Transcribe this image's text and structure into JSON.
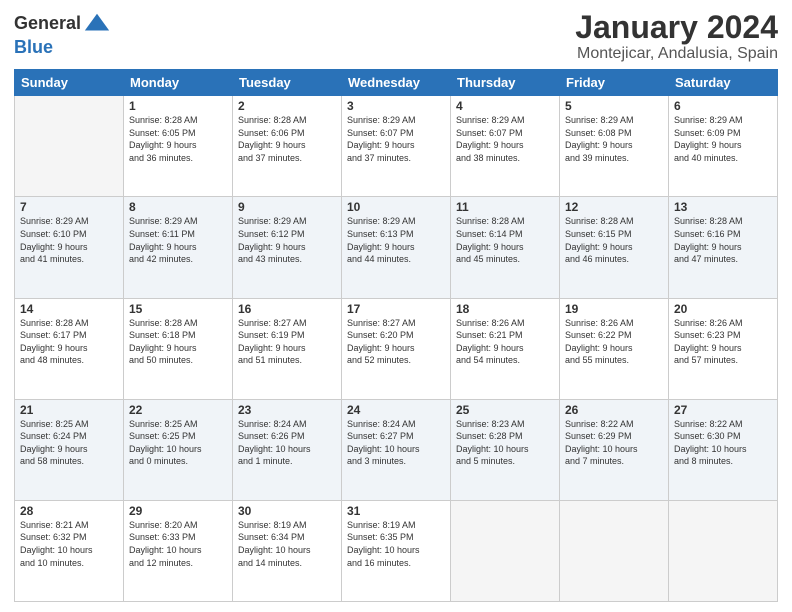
{
  "logo": {
    "general": "General",
    "blue": "Blue"
  },
  "title": "January 2024",
  "subtitle": "Montejicar, Andalusia, Spain",
  "headers": [
    "Sunday",
    "Monday",
    "Tuesday",
    "Wednesday",
    "Thursday",
    "Friday",
    "Saturday"
  ],
  "weeks": [
    [
      {
        "day": "",
        "info": ""
      },
      {
        "day": "1",
        "info": "Sunrise: 8:28 AM\nSunset: 6:05 PM\nDaylight: 9 hours\nand 36 minutes."
      },
      {
        "day": "2",
        "info": "Sunrise: 8:28 AM\nSunset: 6:06 PM\nDaylight: 9 hours\nand 37 minutes."
      },
      {
        "day": "3",
        "info": "Sunrise: 8:29 AM\nSunset: 6:07 PM\nDaylight: 9 hours\nand 37 minutes."
      },
      {
        "day": "4",
        "info": "Sunrise: 8:29 AM\nSunset: 6:07 PM\nDaylight: 9 hours\nand 38 minutes."
      },
      {
        "day": "5",
        "info": "Sunrise: 8:29 AM\nSunset: 6:08 PM\nDaylight: 9 hours\nand 39 minutes."
      },
      {
        "day": "6",
        "info": "Sunrise: 8:29 AM\nSunset: 6:09 PM\nDaylight: 9 hours\nand 40 minutes."
      }
    ],
    [
      {
        "day": "7",
        "info": "Sunrise: 8:29 AM\nSunset: 6:10 PM\nDaylight: 9 hours\nand 41 minutes."
      },
      {
        "day": "8",
        "info": "Sunrise: 8:29 AM\nSunset: 6:11 PM\nDaylight: 9 hours\nand 42 minutes."
      },
      {
        "day": "9",
        "info": "Sunrise: 8:29 AM\nSunset: 6:12 PM\nDaylight: 9 hours\nand 43 minutes."
      },
      {
        "day": "10",
        "info": "Sunrise: 8:29 AM\nSunset: 6:13 PM\nDaylight: 9 hours\nand 44 minutes."
      },
      {
        "day": "11",
        "info": "Sunrise: 8:28 AM\nSunset: 6:14 PM\nDaylight: 9 hours\nand 45 minutes."
      },
      {
        "day": "12",
        "info": "Sunrise: 8:28 AM\nSunset: 6:15 PM\nDaylight: 9 hours\nand 46 minutes."
      },
      {
        "day": "13",
        "info": "Sunrise: 8:28 AM\nSunset: 6:16 PM\nDaylight: 9 hours\nand 47 minutes."
      }
    ],
    [
      {
        "day": "14",
        "info": "Sunrise: 8:28 AM\nSunset: 6:17 PM\nDaylight: 9 hours\nand 48 minutes."
      },
      {
        "day": "15",
        "info": "Sunrise: 8:28 AM\nSunset: 6:18 PM\nDaylight: 9 hours\nand 50 minutes."
      },
      {
        "day": "16",
        "info": "Sunrise: 8:27 AM\nSunset: 6:19 PM\nDaylight: 9 hours\nand 51 minutes."
      },
      {
        "day": "17",
        "info": "Sunrise: 8:27 AM\nSunset: 6:20 PM\nDaylight: 9 hours\nand 52 minutes."
      },
      {
        "day": "18",
        "info": "Sunrise: 8:26 AM\nSunset: 6:21 PM\nDaylight: 9 hours\nand 54 minutes."
      },
      {
        "day": "19",
        "info": "Sunrise: 8:26 AM\nSunset: 6:22 PM\nDaylight: 9 hours\nand 55 minutes."
      },
      {
        "day": "20",
        "info": "Sunrise: 8:26 AM\nSunset: 6:23 PM\nDaylight: 9 hours\nand 57 minutes."
      }
    ],
    [
      {
        "day": "21",
        "info": "Sunrise: 8:25 AM\nSunset: 6:24 PM\nDaylight: 9 hours\nand 58 minutes."
      },
      {
        "day": "22",
        "info": "Sunrise: 8:25 AM\nSunset: 6:25 PM\nDaylight: 10 hours\nand 0 minutes."
      },
      {
        "day": "23",
        "info": "Sunrise: 8:24 AM\nSunset: 6:26 PM\nDaylight: 10 hours\nand 1 minute."
      },
      {
        "day": "24",
        "info": "Sunrise: 8:24 AM\nSunset: 6:27 PM\nDaylight: 10 hours\nand 3 minutes."
      },
      {
        "day": "25",
        "info": "Sunrise: 8:23 AM\nSunset: 6:28 PM\nDaylight: 10 hours\nand 5 minutes."
      },
      {
        "day": "26",
        "info": "Sunrise: 8:22 AM\nSunset: 6:29 PM\nDaylight: 10 hours\nand 7 minutes."
      },
      {
        "day": "27",
        "info": "Sunrise: 8:22 AM\nSunset: 6:30 PM\nDaylight: 10 hours\nand 8 minutes."
      }
    ],
    [
      {
        "day": "28",
        "info": "Sunrise: 8:21 AM\nSunset: 6:32 PM\nDaylight: 10 hours\nand 10 minutes."
      },
      {
        "day": "29",
        "info": "Sunrise: 8:20 AM\nSunset: 6:33 PM\nDaylight: 10 hours\nand 12 minutes."
      },
      {
        "day": "30",
        "info": "Sunrise: 8:19 AM\nSunset: 6:34 PM\nDaylight: 10 hours\nand 14 minutes."
      },
      {
        "day": "31",
        "info": "Sunrise: 8:19 AM\nSunset: 6:35 PM\nDaylight: 10 hours\nand 16 minutes."
      },
      {
        "day": "",
        "info": ""
      },
      {
        "day": "",
        "info": ""
      },
      {
        "day": "",
        "info": ""
      }
    ]
  ]
}
